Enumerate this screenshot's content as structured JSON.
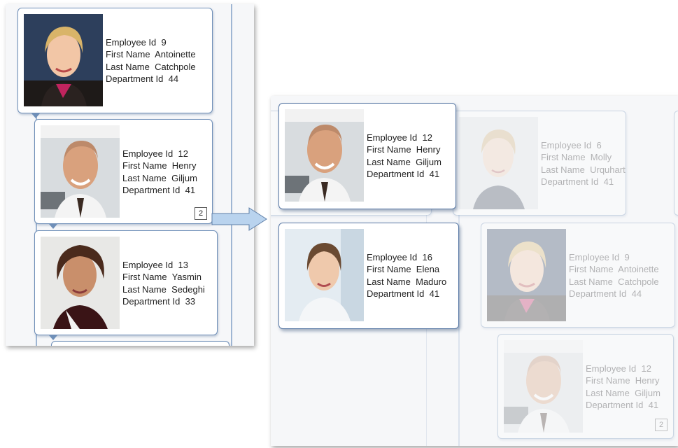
{
  "labels": {
    "employee_id": "Employee Id",
    "first_name": "First Name",
    "last_name": "Last Name",
    "department_id": "Department Id"
  },
  "left_panel": {
    "cards": [
      {
        "employee_id": "9",
        "first_name": "Antoinette",
        "last_name": "Catchpole",
        "department_id": "44",
        "photo": "woman-blonde-photo"
      },
      {
        "employee_id": "12",
        "first_name": "Henry",
        "last_name": "Giljum",
        "department_id": "41",
        "photo": "man-bald-photo",
        "counter": "2"
      },
      {
        "employee_id": "13",
        "first_name": "Yasmin",
        "last_name": "Sedeghi",
        "department_id": "33",
        "photo": "woman-curly-photo"
      }
    ]
  },
  "right_panel": {
    "active_cards": [
      {
        "employee_id": "12",
        "first_name": "Henry",
        "last_name": "Giljum",
        "department_id": "41",
        "photo": "man-bald-photo"
      },
      {
        "employee_id": "16",
        "first_name": "Elena",
        "last_name": "Maduro",
        "department_id": "41",
        "photo": "woman-brunette-photo"
      }
    ],
    "faded_cards": [
      {
        "employee_id": "6",
        "first_name": "Molly",
        "last_name": "Urquhart",
        "department_id": "41",
        "photo": "woman-shorthair-photo"
      },
      {
        "employee_id": "9",
        "first_name": "Antoinette",
        "last_name": "Catchpole",
        "department_id": "44",
        "photo": "woman-blonde-photo"
      },
      {
        "employee_id": "12",
        "first_name": "Henry",
        "last_name": "Giljum",
        "department_id": "41",
        "photo": "man-bald-photo",
        "counter": "2"
      }
    ]
  },
  "colors": {
    "card_border": "#6f8fb8",
    "arrow_fill": "#b9d3ee"
  }
}
